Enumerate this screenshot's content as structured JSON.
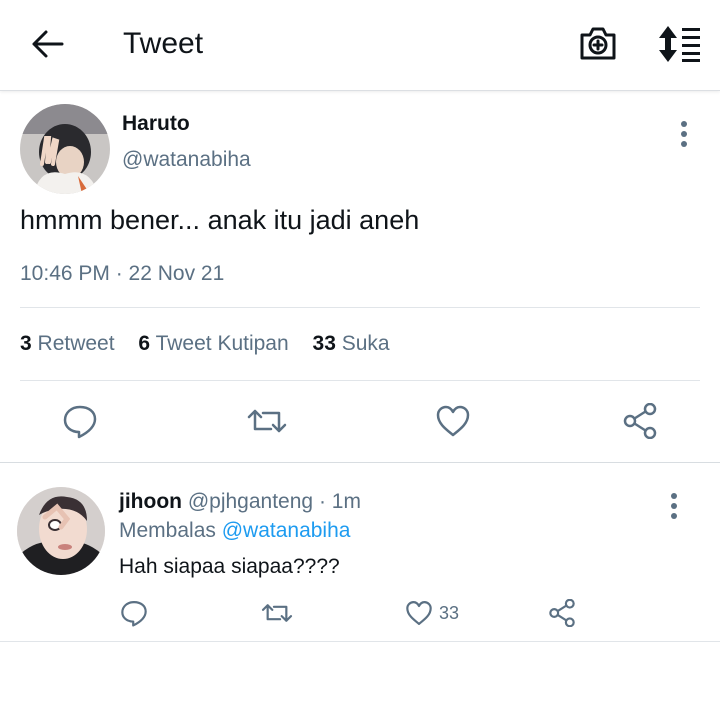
{
  "header": {
    "title": "Tweet",
    "icons": {
      "back": "arrow-left-icon",
      "camera": "camera-plus-icon",
      "sort": "sort-list-icon"
    }
  },
  "tweet": {
    "author_name": "Haruto",
    "author_handle": "@watanabiha",
    "text": "hmmm bener... anak itu jadi aneh",
    "timestamp": "10:46 PM · 22 Nov 21",
    "stats": {
      "retweets_count": "3",
      "retweets_label": "Retweet",
      "quotes_count": "6",
      "quotes_label": "Tweet Kutipan",
      "likes_count": "33",
      "likes_label": "Suka"
    }
  },
  "reply": {
    "author_name": "jihoon",
    "author_handle": "@pjhganteng",
    "time": "· 1m",
    "replying_label": "Membalas",
    "replying_to": "@watanabiha",
    "text": "Hah siapaa siapaa????",
    "like_count": "33"
  },
  "colors": {
    "text_primary": "#0f1419",
    "text_secondary": "#5b7083",
    "link": "#1d9bf0",
    "divider": "#e1e5e9"
  }
}
